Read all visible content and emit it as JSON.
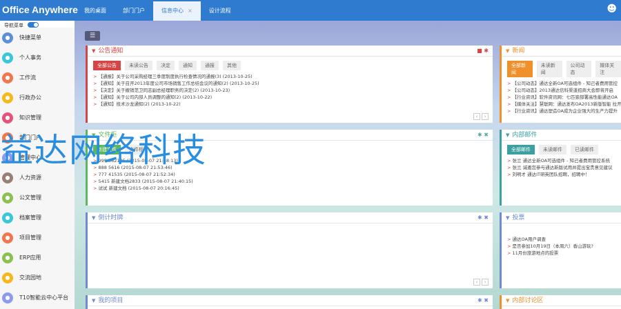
{
  "header": {
    "logo": "Office Anywhere",
    "tabs": [
      "我的桌面",
      "部门门户",
      "信息中心",
      "设计流程"
    ],
    "active_tab_close": "×"
  },
  "nav": {
    "label": "导航菜单"
  },
  "sidebar": [
    {
      "label": "快捷菜单",
      "color": "#5b8fd8"
    },
    {
      "label": "个人事务",
      "color": "#3cc7d8"
    },
    {
      "label": "工作流",
      "color": "#f2764e"
    },
    {
      "label": "行政办公",
      "color": "#f6b81a"
    },
    {
      "label": "知识管理",
      "color": "#e8527a"
    },
    {
      "label": "部门门户",
      "color": "#f2764e"
    },
    {
      "label": "管理中心",
      "color": "#8c9af0"
    },
    {
      "label": "人力资源",
      "color": "#9a7f74"
    },
    {
      "label": "公文管理",
      "color": "#8cc152"
    },
    {
      "label": "档案管理",
      "color": "#3cc7d8"
    },
    {
      "label": "项目管理",
      "color": "#f2764e"
    },
    {
      "label": "ERP应用",
      "color": "#8cc152"
    },
    {
      "label": "交流园地",
      "color": "#f6b81a"
    },
    {
      "label": "T10智能云中心平台",
      "color": "#8c9af0"
    }
  ],
  "panels": {
    "notice": {
      "title": "公告通知",
      "tabs": [
        "全部公告",
        "未读公告",
        "决定",
        "通知",
        "通报",
        "其他"
      ],
      "items": [
        "【通报】关于公司采购经理三季度制度执行检查情况的通报(3) (2013-10-25)",
        "【通知】关于召开2013年度公司市场销售工作总结会议的通知(2) (2013-10-25)",
        "【决定】关于撤销范卫同志副总经理职务的决定(2) (2013-10-23)",
        "【通知】关于公司内部人员调整的通知(2) (2013-10-22)",
        "【通知】技术沙龙通知(2) (2013-10-22)"
      ]
    },
    "news": {
      "title": "新闻",
      "tabs": [
        "全部新闻",
        "未读新闻",
        "公司动态",
        "媒体关注"
      ],
      "items": [
        "【公司动态】通达全新OA可选组件 - 知己者费用管控",
        "【公司动态】2013通达信科渠道招商大会即将开启",
        "【行业资讯】软件资讯网：七匹狼部署高性能通达OA",
        "【媒体关注】慧聪网：通达发布OA2013新版智能 拉开",
        "【行业资讯】通达塑造OA成为企业强大的生产力提升"
      ]
    },
    "files": {
      "title": "文件柜",
      "tabs": [
        "新建文件",
        "文件柜"
      ],
      "items": [
        "999 382195 (2015-08-07 21:58:13)",
        "888 5616 (2015-08-07 21:53:46)",
        "777 41535 (2015-08-07 21:52:34)",
        "5415 新建文档2833 (2015-08-07 21:40:15)",
        "试试 新建文档 (2015-08-07 20:16:45)"
      ]
    },
    "mail": {
      "title": "内部邮件",
      "tabs": [
        "全部邮件",
        "未读邮件",
        "已读邮件"
      ],
      "items": [
        "张兰 通达全新OA可选组件 - 知己者费用管控系统",
        "张兰 诚邀您参与通达新版试用并提出宝贵意见建议",
        "刘明才 通达IT研英团队招聘，招聘中！"
      ]
    },
    "countdown": {
      "title": "倒计时牌"
    },
    "vote": {
      "title": "投票",
      "items": [
        "通达OA用户调查",
        "是否参加10月19日（本周六）香山游玩?",
        "11月份旅游地点的投票"
      ]
    },
    "project": {
      "title": "我的项目"
    },
    "forum": {
      "title": "内部讨论区"
    }
  },
  "watermark": "益达网络科技"
}
